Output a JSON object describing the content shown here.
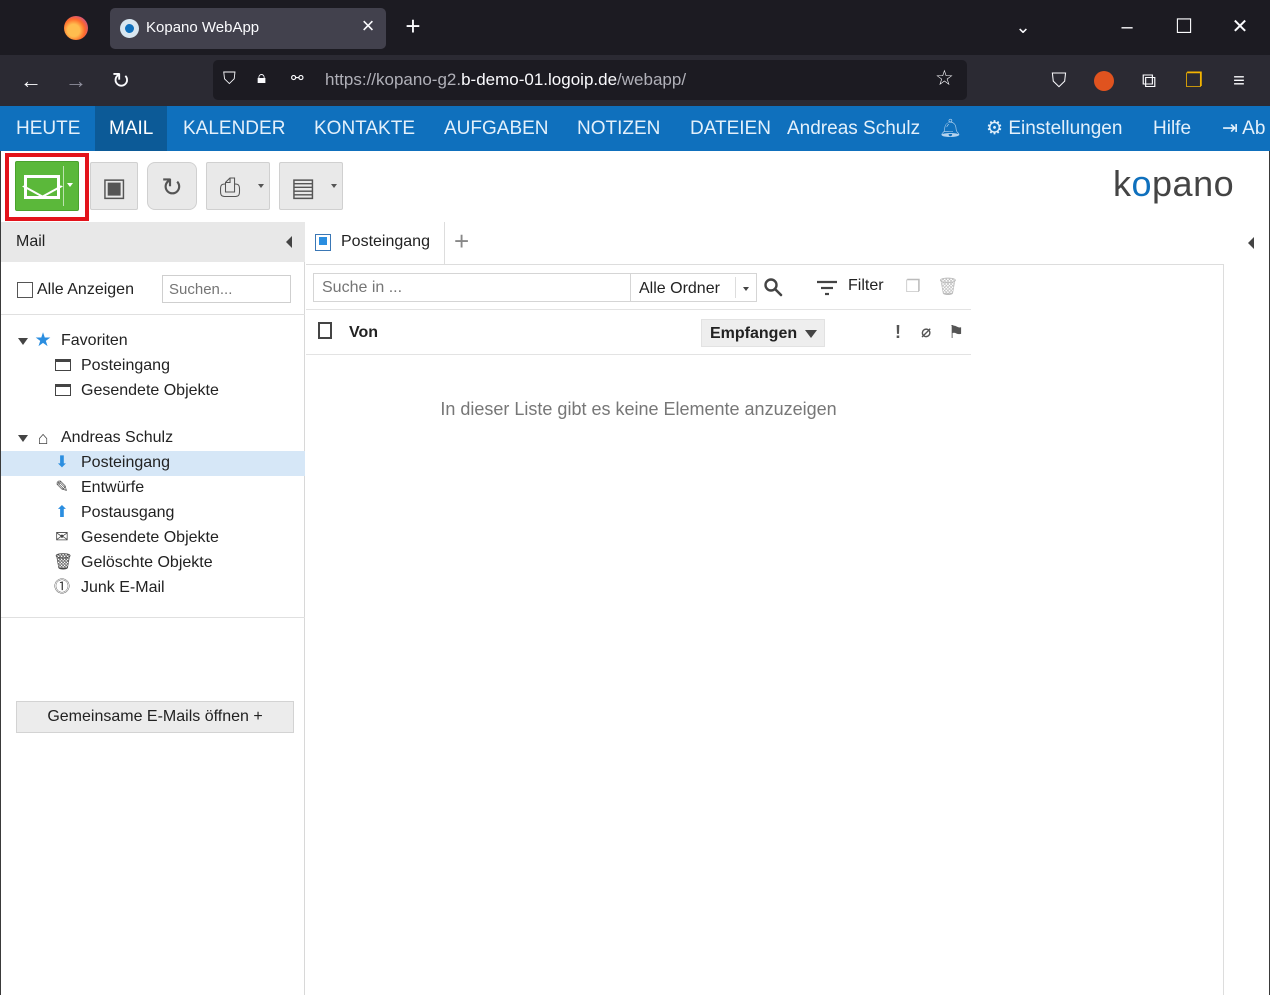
{
  "browser": {
    "tab_title": "Kopano WebApp",
    "url_prefix": "https://kopano-g2.",
    "url_domain": "b-demo-01.logoip.de",
    "url_suffix": "/webapp/"
  },
  "app_nav": {
    "items": [
      "HEUTE",
      "MAIL",
      "KALENDER",
      "KONTAKTE",
      "AUFGABEN",
      "NOTIZEN",
      "DATEIEN"
    ],
    "active": "MAIL",
    "user": "Andreas Schulz",
    "settings": "Einstellungen",
    "help": "Hilfe",
    "logout": "Ab"
  },
  "brand": {
    "logo_k": "k",
    "logo_o": "o",
    "logo_rest": "pano",
    "accent": "#0f70bd",
    "new_mail_color": "#5bb83a"
  },
  "left_panel": {
    "title": "Mail",
    "show_all_label": "Alle Anzeigen",
    "search_placeholder": "Suchen...",
    "favorites": {
      "label": "Favoriten",
      "items": [
        "Posteingang",
        "Gesendete Objekte"
      ]
    },
    "mailbox": {
      "label": "Andreas Schulz",
      "items": [
        "Posteingang",
        "Entwürfe",
        "Postausgang",
        "Gesendete Objekte",
        "Gelöschte Objekte",
        "Junk E-Mail"
      ],
      "selected": "Posteingang"
    },
    "shared_button": "Gemeinsame E-Mails öffnen +"
  },
  "main": {
    "tab_label": "Posteingang",
    "search_placeholder": "Suche in ...",
    "folder_scope": "Alle Ordner",
    "filter_label": "Filter",
    "col_from": "Von",
    "col_received": "Empfangen",
    "empty_message": "In dieser Liste gibt es keine Elemente anzuzeigen"
  }
}
